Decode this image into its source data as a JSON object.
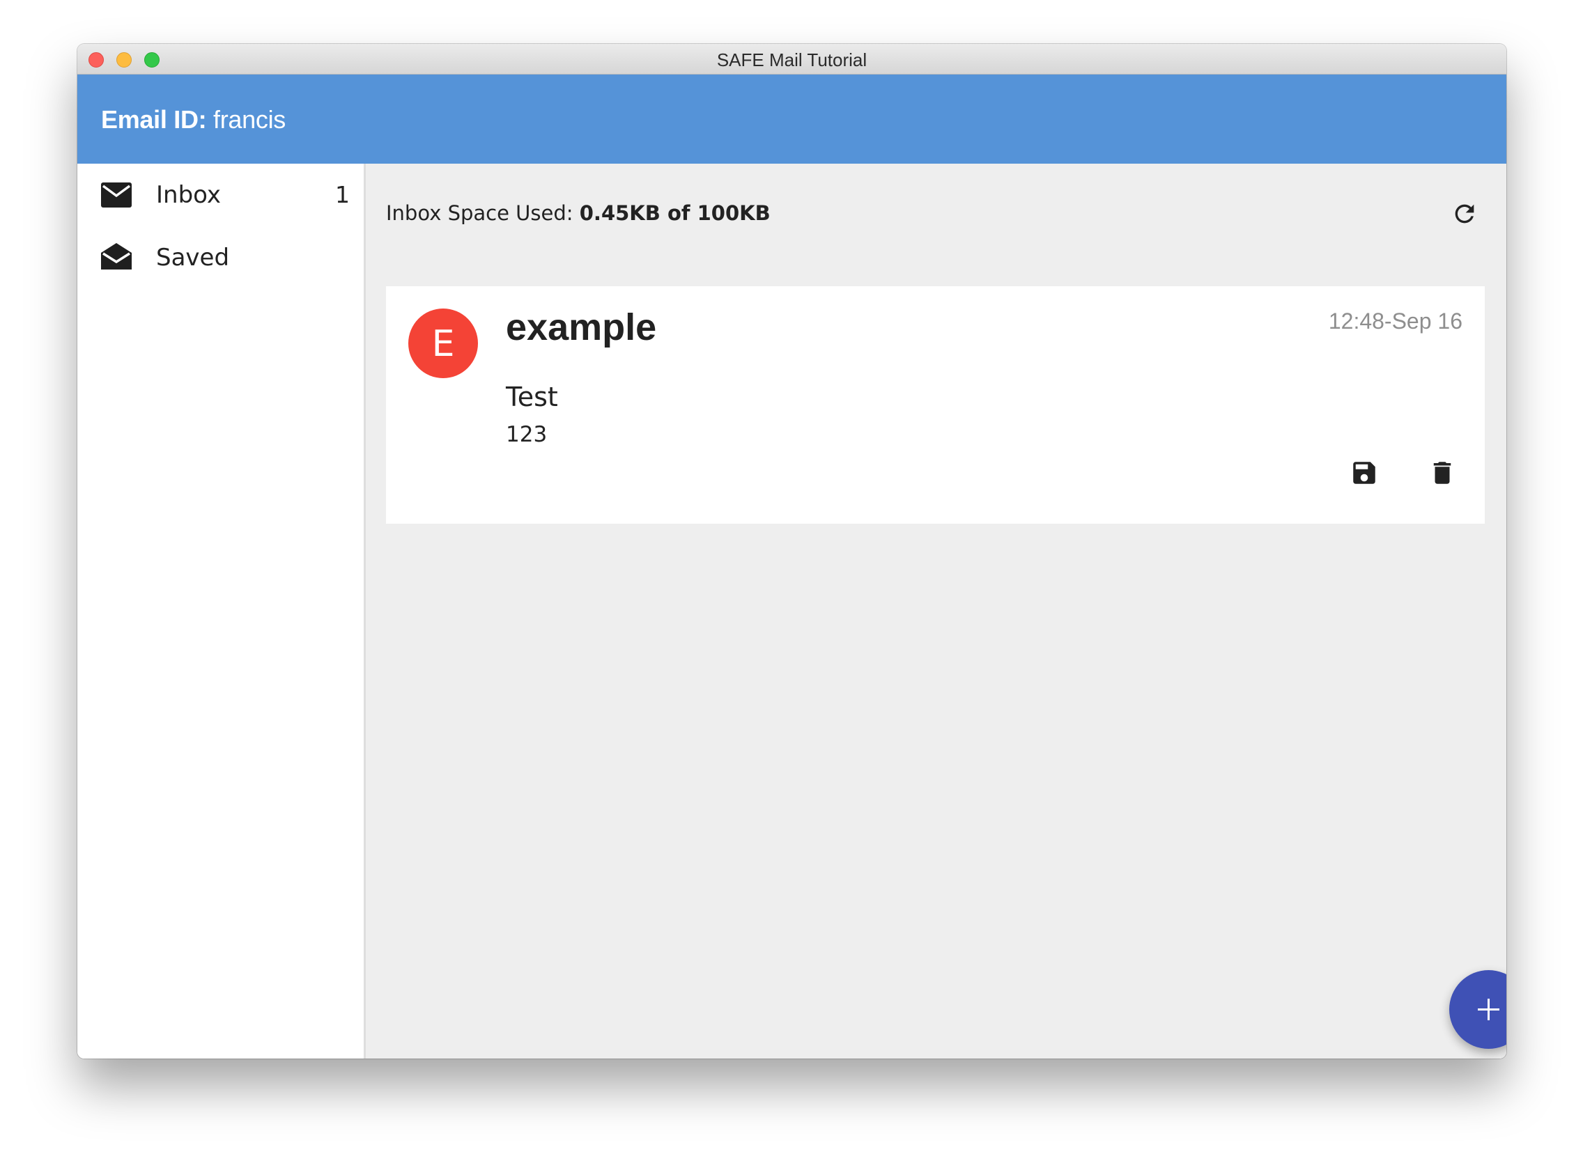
{
  "window": {
    "title": "SAFE Mail Tutorial"
  },
  "header": {
    "label": "Email ID:",
    "user": "francis",
    "color": "#5593d8"
  },
  "sidebar": {
    "items": [
      {
        "label": "Inbox",
        "count": "1",
        "icon": "mail-icon"
      },
      {
        "label": "Saved",
        "count": "",
        "icon": "drafts-icon"
      }
    ]
  },
  "main": {
    "space_label": "Inbox Space Used:",
    "space_value": "0.45KB of 100KB",
    "refresh_icon": "refresh-icon"
  },
  "messages": [
    {
      "avatar_letter": "E",
      "avatar_color": "#f44336",
      "sender": "example",
      "timestamp": "12:48-Sep 16",
      "subject": "Test",
      "body": "123",
      "actions": [
        "save-icon",
        "delete-icon"
      ]
    }
  ],
  "fab": {
    "icon": "plus-icon",
    "color": "#3f51b5"
  }
}
